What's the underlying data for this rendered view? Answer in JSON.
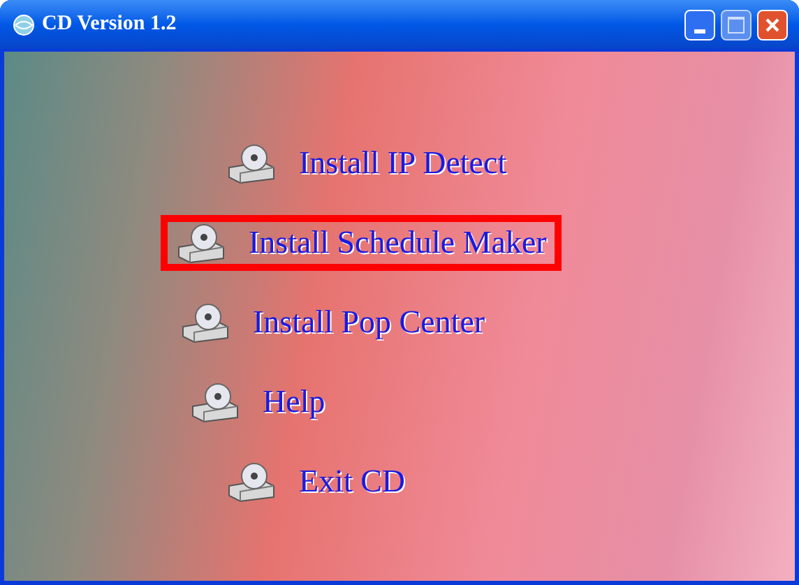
{
  "window": {
    "title": "CD Version 1.2"
  },
  "menu": [
    {
      "label": "Install IP Detect",
      "selected": false
    },
    {
      "label": "Install Schedule Maker",
      "selected": true
    },
    {
      "label": "Install Pop Center",
      "selected": false
    },
    {
      "label": "Help",
      "selected": false
    },
    {
      "label": "Exit CD",
      "selected": false
    }
  ]
}
